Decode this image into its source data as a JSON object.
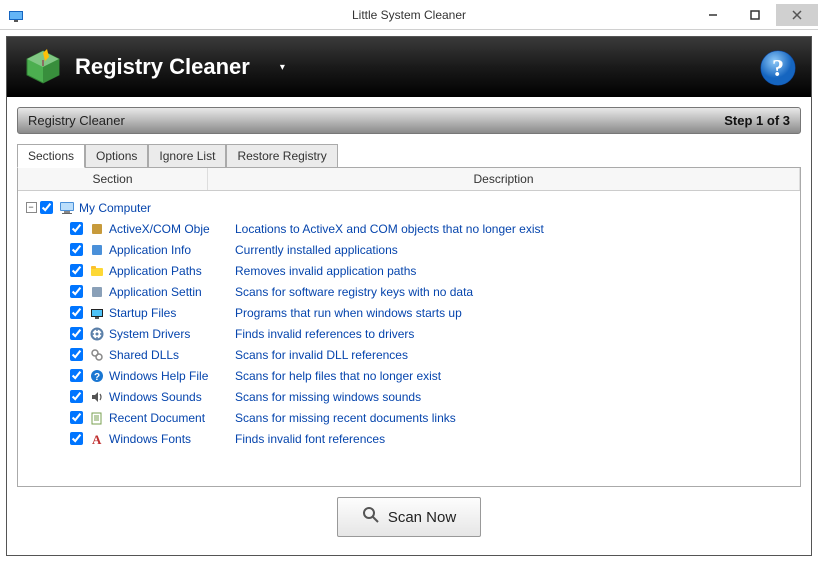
{
  "window": {
    "title": "Little System Cleaner"
  },
  "header": {
    "title": "Registry Cleaner"
  },
  "stepbar": {
    "left": "Registry Cleaner",
    "right": "Step 1 of 3"
  },
  "tabs": [
    {
      "label": "Sections"
    },
    {
      "label": "Options"
    },
    {
      "label": "Ignore List"
    },
    {
      "label": "Restore Registry"
    }
  ],
  "columns": {
    "section": "Section",
    "description": "Description"
  },
  "tree": {
    "root": {
      "label": "My Computer"
    },
    "items": [
      {
        "label": "ActiveX/COM Obje",
        "desc": "Locations to ActiveX and COM objects that no longer exist",
        "icon": "activex"
      },
      {
        "label": "Application Info",
        "desc": "Currently installed applications",
        "icon": "appinfo"
      },
      {
        "label": "Application Paths",
        "desc": "Removes invalid application paths",
        "icon": "apppaths"
      },
      {
        "label": "Application Settin",
        "desc": "Scans for software registry keys with no data",
        "icon": "appsettings"
      },
      {
        "label": "Startup Files",
        "desc": "Programs that run when windows starts up",
        "icon": "startup"
      },
      {
        "label": "System Drivers",
        "desc": "Finds invalid references to drivers",
        "icon": "drivers"
      },
      {
        "label": "Shared DLLs",
        "desc": "Scans for invalid DLL references",
        "icon": "dlls"
      },
      {
        "label": "Windows Help File",
        "desc": "Scans for help files that no longer exist",
        "icon": "help"
      },
      {
        "label": "Windows Sounds",
        "desc": "Scans for missing windows sounds",
        "icon": "sounds"
      },
      {
        "label": "Recent Document",
        "desc": "Scans for missing recent documents links",
        "icon": "recent"
      },
      {
        "label": "Windows Fonts",
        "desc": "Finds invalid font references",
        "icon": "fonts"
      }
    ]
  },
  "footer": {
    "scan": "Scan Now"
  },
  "icons": {
    "activex": "#c79a3b",
    "appinfo": "#4a90d9",
    "apppaths": "#d9b84a",
    "appsettings": "#8aa0b8",
    "startup": "#2a2a2a",
    "drivers": "#5a7fa8",
    "dlls": "#888888",
    "help": "#2860c8",
    "sounds": "#707070",
    "recent": "#7aa050",
    "fonts": "#c03030"
  }
}
